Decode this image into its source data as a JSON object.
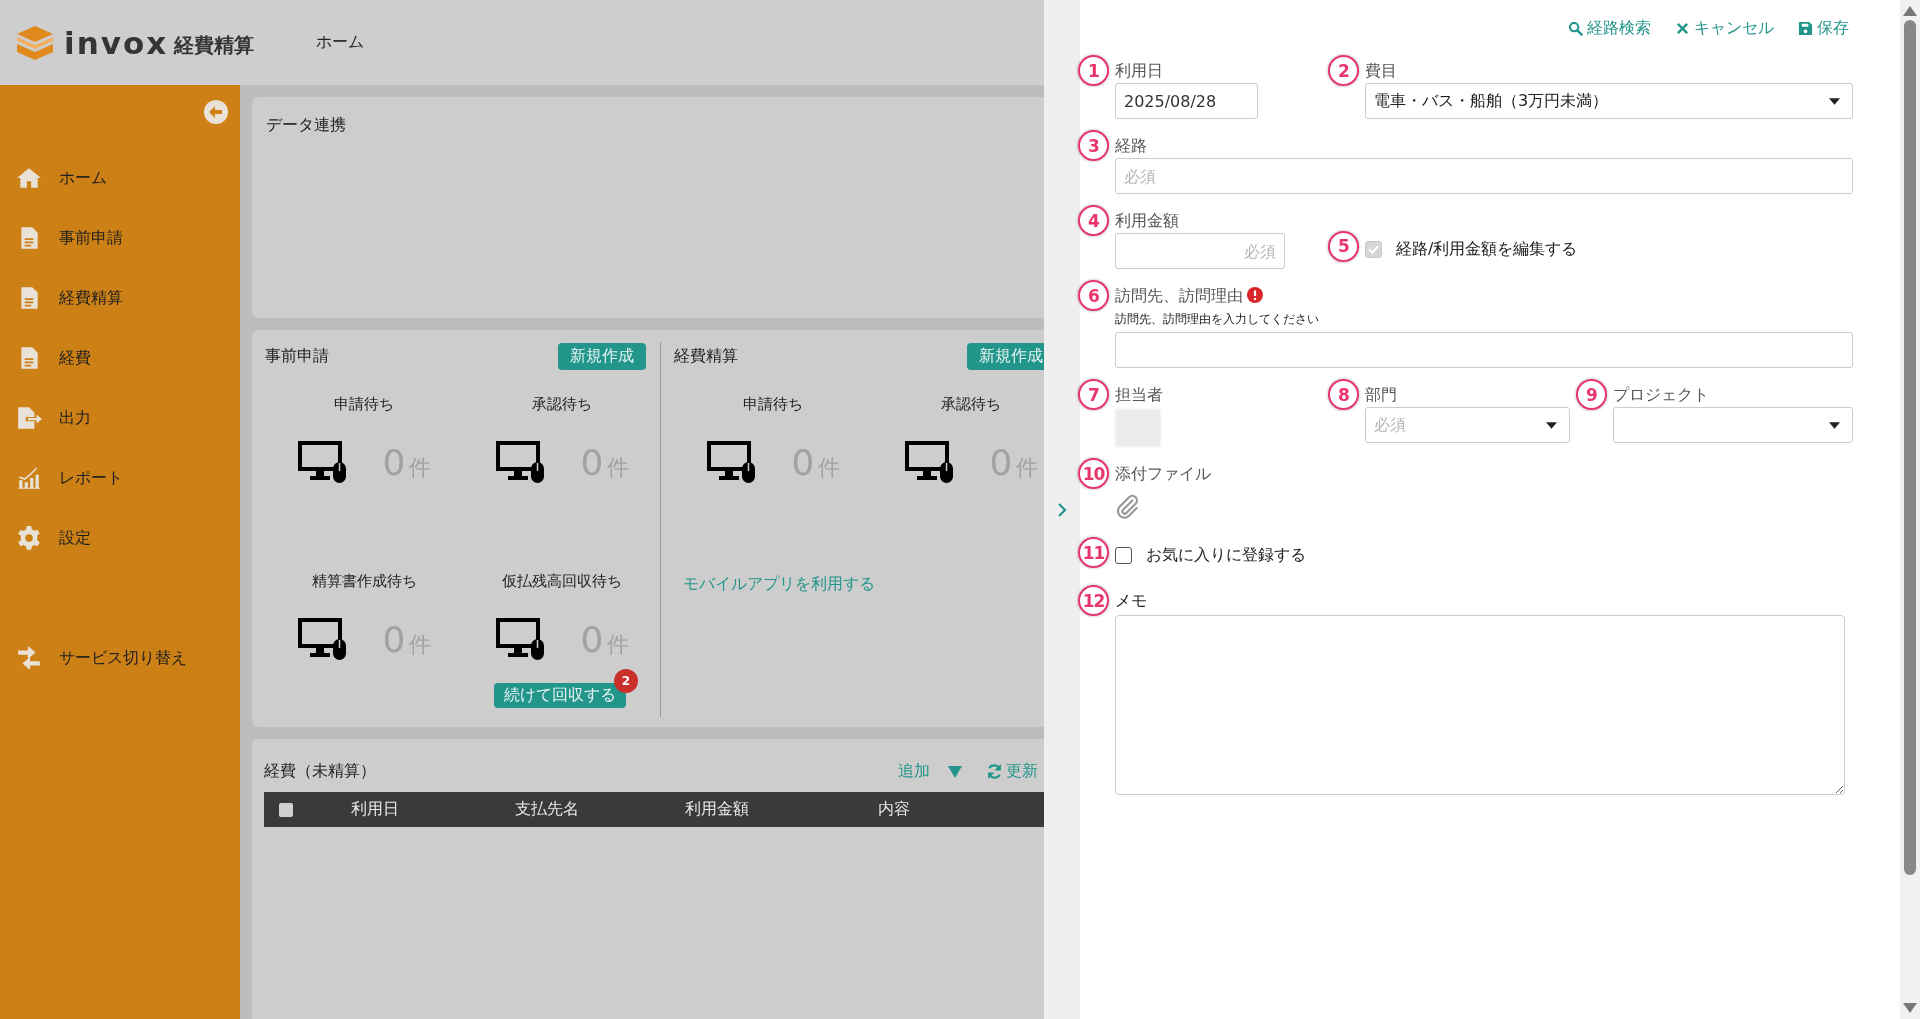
{
  "header": {
    "logo_word": "invox",
    "logo_product": "経費精算",
    "breadcrumb": "ホーム"
  },
  "sidebar": {
    "items": [
      {
        "kind": "home",
        "label": "ホーム"
      },
      {
        "kind": "document",
        "label": "事前申請"
      },
      {
        "kind": "document",
        "label": "経費精算"
      },
      {
        "kind": "document",
        "label": "経費"
      },
      {
        "kind": "export",
        "label": "出力"
      },
      {
        "kind": "chart",
        "label": "レポート"
      },
      {
        "kind": "gear",
        "label": "設定"
      }
    ],
    "footer_item": {
      "kind": "switch",
      "label": "サービス切り替え"
    }
  },
  "data_link": {
    "title": "データ連携"
  },
  "panels": [
    {
      "title": "事前申請",
      "new_button": "新規作成",
      "stats": [
        {
          "label": "申請待ち",
          "count": "0",
          "unit": "件"
        },
        {
          "label": "承認待ち",
          "count": "0",
          "unit": "件"
        },
        {
          "label": "精算書作成待ち",
          "count": "0",
          "unit": "件"
        },
        {
          "label": "仮払残高回収待ち",
          "count": "0",
          "unit": "件"
        }
      ],
      "action": {
        "label": "続けて回収する",
        "badge": "2"
      }
    },
    {
      "title": "経費精算",
      "new_button": "新規作成",
      "stats": [
        {
          "label": "申請待ち",
          "count": "0",
          "unit": "件"
        },
        {
          "label": "承認待ち",
          "count": "0",
          "unit": "件"
        }
      ],
      "link": "モバイルアプリを利用する"
    }
  ],
  "expenses": {
    "title": "経費（未精算）",
    "add": "追加",
    "refresh": "更新",
    "select_all_checked": false,
    "columns": [
      "利用日",
      "支払先名",
      "利用金額",
      "内容"
    ]
  },
  "form": {
    "actions": [
      {
        "kind": "search",
        "label": "経路検索"
      },
      {
        "kind": "cancel",
        "label": "キャンセル"
      },
      {
        "kind": "save",
        "label": "保存"
      }
    ],
    "date": {
      "marker": "1",
      "label": "利用日",
      "value": "2025/08/28"
    },
    "category": {
      "marker": "2",
      "label": "費目",
      "value": "電車・バス・船舶（3万円未満）"
    },
    "route": {
      "marker": "3",
      "label": "経路",
      "placeholder": "必須"
    },
    "amount": {
      "marker": "4",
      "label": "利用金額",
      "placeholder": "必須"
    },
    "edit_toggle": {
      "marker": "5",
      "label": "経路/利用金額を編集する",
      "checked": true,
      "disabled": true
    },
    "visit": {
      "marker": "6",
      "label": "訪問先、訪問理由",
      "error": true,
      "hint": "訪問先、訪問理由を入力してください"
    },
    "person": {
      "marker": "7",
      "label": "担当者"
    },
    "department": {
      "marker": "8",
      "label": "部門",
      "placeholder": "必須"
    },
    "project": {
      "marker": "9",
      "label": "プロジェクト"
    },
    "attachment": {
      "marker": "10",
      "label": "添付ファイル"
    },
    "favorite": {
      "marker": "11",
      "label": "お気に入りに登録する",
      "checked": false,
      "disabled": false
    },
    "memo": {
      "marker": "12",
      "label": "メモ"
    }
  }
}
